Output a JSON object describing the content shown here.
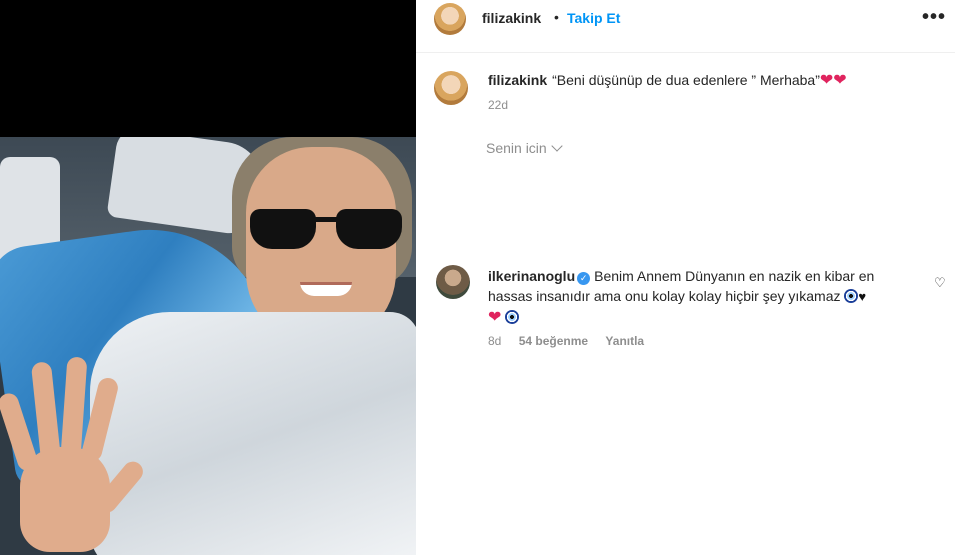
{
  "post": {
    "author": "filizakink",
    "follow_label": "Takip Et",
    "separator": "•",
    "more_icon": "more-horizontal-icon",
    "caption_text": "“Beni düşünüp de dua edenlere ” Merhaba”",
    "caption_time": "22d",
    "for_you_label": "Senin icin"
  },
  "comment": {
    "username": "ilkerinanoglu",
    "text": "Benim Annem Dünyanın en nazik en kibar en hassas insanıdır ama onu kolay kolay hiçbir şey yıkamaz",
    "time": "8d",
    "likes": "54 beğenme",
    "reply_label": "Yanıtla"
  },
  "colors": {
    "accent": "#0095f6",
    "heart": "#e0245e",
    "verified": "#3897f0"
  }
}
